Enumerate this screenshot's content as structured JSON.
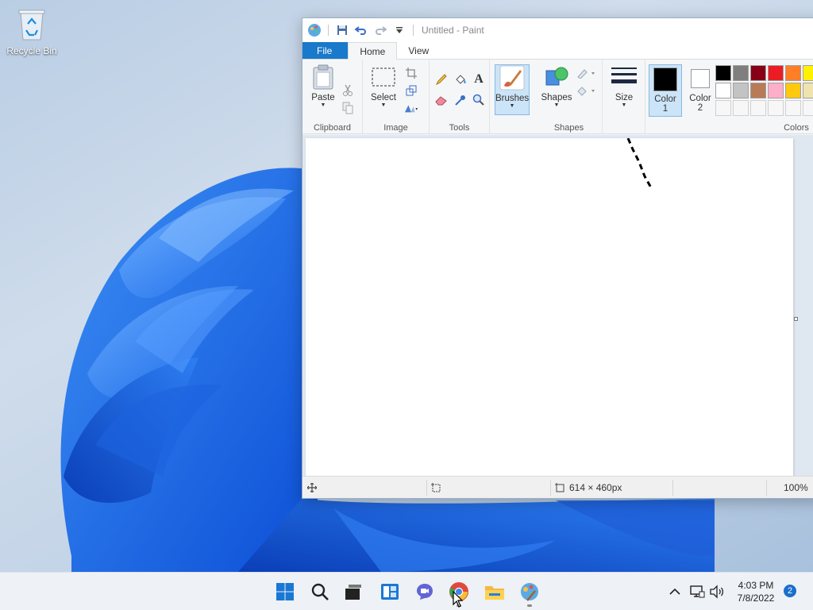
{
  "desktop": {
    "recycle_bin_label": "Recycle Bin"
  },
  "paint": {
    "title": "Untitled - Paint",
    "tabs": [
      {
        "label": "File"
      },
      {
        "label": "Home"
      },
      {
        "label": "View"
      }
    ],
    "ribbon": {
      "clipboard": {
        "paste_label": "Paste",
        "group_label": "Clipboard"
      },
      "image": {
        "select_label": "Select",
        "group_label": "Image"
      },
      "tools": {
        "group_label": "Tools"
      },
      "brushes": {
        "label": "Brushes"
      },
      "shapes": {
        "label": "Shapes",
        "group_label": "Shapes"
      },
      "size": {
        "label": "Size"
      },
      "color1": {
        "line1": "Color",
        "line2": "1",
        "value": "#000000"
      },
      "color2": {
        "line1": "Color",
        "line2": "2",
        "value": "#ffffff"
      },
      "colors_group_label": "Colors",
      "palette_row1": [
        "#000000",
        "#7f7f7f",
        "#880015",
        "#ed1c24",
        "#ff7f27",
        "#fff200"
      ],
      "palette_row2": [
        "#ffffff",
        "#c3c3c3",
        "#b97a57",
        "#ffaec9",
        "#ffc90e",
        "#efe4b0"
      ]
    },
    "status": {
      "canvas_size": "614 × 460px",
      "zoom": "100%"
    }
  },
  "taskbar": {
    "time": "4:03 PM",
    "date": "7/8/2022",
    "notification_count": "2"
  },
  "colors": {
    "accent": "#1979ca",
    "selection_bg": "#cce4f7"
  }
}
